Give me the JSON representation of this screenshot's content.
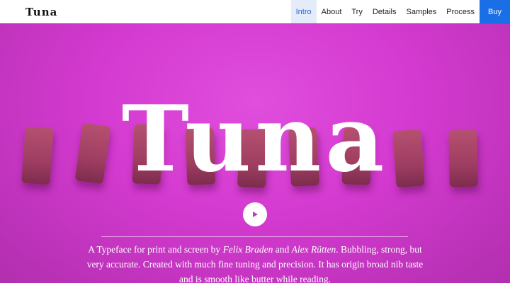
{
  "brand": "Tuna",
  "nav": {
    "items": [
      "Intro",
      "About",
      "Try",
      "Details",
      "Samples",
      "Process"
    ],
    "active": "Intro",
    "buy_label": "Buy"
  },
  "hero": {
    "title": "Tuna",
    "play_icon": "play-icon",
    "description": {
      "part1": "A Typeface for print and screen by ",
      "author1": "Felix Braden",
      "part2": " and ",
      "author2": "Alex Rütten",
      "part3": ". Bubbling, strong, but very accurate. Created with much fine tuning and precision. It has origin broad nib taste and is smooth like butter while reading."
    }
  },
  "colors": {
    "background": "#d63ed2",
    "buy": "#1a6ee6",
    "active_tab": "#2a64d8"
  }
}
